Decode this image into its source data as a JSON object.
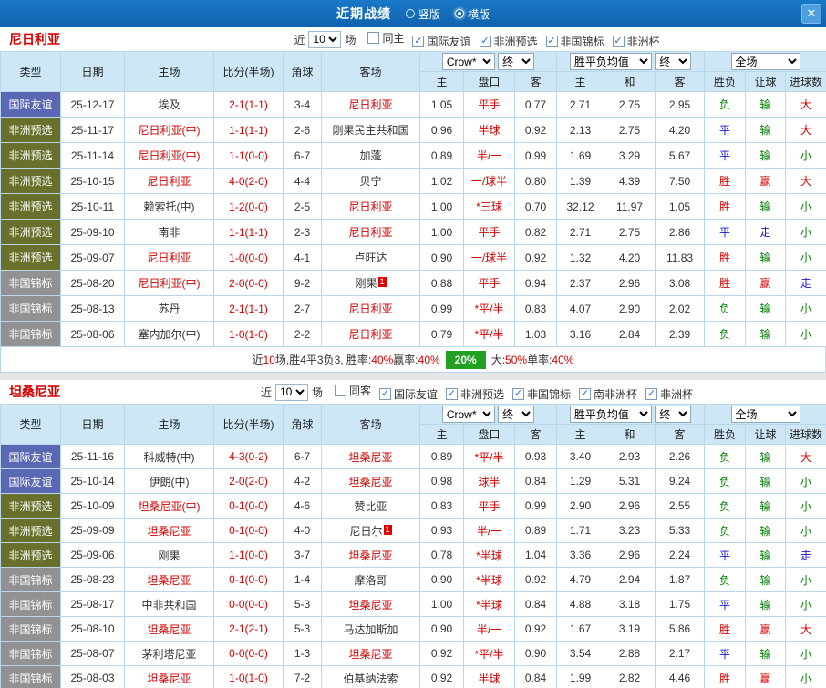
{
  "titlebar": {
    "title": "近期战绩",
    "layout_radios": [
      {
        "label": "竖版",
        "selected": false
      },
      {
        "label": "横版",
        "selected": true
      }
    ],
    "close_icon": "✕"
  },
  "labels": {
    "near": "近",
    "count": "10",
    "games": "场"
  },
  "table_meta": {
    "col_headers": [
      "类型",
      "日期",
      "主场",
      "比分(半场)",
      "角球",
      "客场"
    ],
    "sub_headers": [
      "主",
      "盘口",
      "客",
      "主",
      "和",
      "客",
      "胜负",
      "让球",
      "进球数"
    ],
    "dd_odds": "Crow*",
    "dd_final": "终",
    "dd_europe": "胜平负均值",
    "dd_scope": "全场"
  },
  "colors": {
    "accent": "#1269b7",
    "type_bg": {
      "国际友谊": "#5a68b4",
      "非洲预选": "#68702c",
      "非国锦标": "#929292"
    },
    "value": {
      "red": "#d60000",
      "blue": "#1414d6",
      "green": "#008000"
    },
    "score": "#d60000",
    "badge_green": "#22a022"
  },
  "value_kind": {
    "胜": "red",
    "赢": "red",
    "大": "red",
    "平": "blue",
    "走": "blue",
    "负": "green",
    "输": "green",
    "小": "green"
  },
  "sections": [
    {
      "team": "尼日利亚",
      "filters": [
        {
          "label": "同主",
          "checked": false
        },
        {
          "label": "国际友谊",
          "checked": true
        },
        {
          "label": "非洲预选",
          "checked": true
        },
        {
          "label": "非国锦标",
          "checked": true
        },
        {
          "label": "非洲杯",
          "checked": true
        }
      ],
      "rows": [
        {
          "type": "国际友谊",
          "date": "25-12-17",
          "home": "埃及",
          "hf": false,
          "score": "2-1(1-1)",
          "corner": "3-4",
          "away": "尼日利亚",
          "af": true,
          "w1": "1.05",
          "hc": "平手",
          "w2": "0.77",
          "o1": "2.71",
          "o2": "2.75",
          "o3": "2.95",
          "res": "负",
          "ah": "输",
          "gl": "大"
        },
        {
          "type": "非洲预选",
          "date": "25-11-17",
          "home": "尼日利亚(中)",
          "hf": true,
          "score": "1-1(1-1)",
          "corner": "2-6",
          "away": "刚果民主共和国",
          "af": false,
          "w1": "0.96",
          "hc": "半球",
          "w2": "0.92",
          "o1": "2.13",
          "o2": "2.75",
          "o3": "4.20",
          "res": "平",
          "ah": "输",
          "gl": "大"
        },
        {
          "type": "非洲预选",
          "date": "25-11-14",
          "home": "尼日利亚(中)",
          "hf": true,
          "score": "1-1(0-0)",
          "corner": "6-7",
          "away": "加蓬",
          "af": false,
          "w1": "0.89",
          "hc": "半/一",
          "w2": "0.99",
          "o1": "1.69",
          "o2": "3.29",
          "o3": "5.67",
          "res": "平",
          "ah": "输",
          "gl": "小"
        },
        {
          "type": "非洲预选",
          "date": "25-10-15",
          "home": "尼日利亚",
          "hf": true,
          "score": "4-0(2-0)",
          "corner": "4-4",
          "away": "贝宁",
          "af": false,
          "w1": "1.02",
          "hc": "一/球半",
          "w2": "0.80",
          "o1": "1.39",
          "o2": "4.39",
          "o3": "7.50",
          "res": "胜",
          "ah": "赢",
          "gl": "大"
        },
        {
          "type": "非洲预选",
          "date": "25-10-11",
          "home": "赖索托(中)",
          "hf": false,
          "score": "1-2(0-0)",
          "corner": "2-5",
          "away": "尼日利亚",
          "af": true,
          "w1": "1.00",
          "hc": "*三球",
          "w2": "0.70",
          "o1": "32.12",
          "o2": "11.97",
          "o3": "1.05",
          "res": "胜",
          "ah": "输",
          "gl": "小"
        },
        {
          "type": "非洲预选",
          "date": "25-09-10",
          "home": "南非",
          "hf": false,
          "score": "1-1(1-1)",
          "corner": "2-3",
          "away": "尼日利亚",
          "af": true,
          "w1": "1.00",
          "hc": "平手",
          "w2": "0.82",
          "o1": "2.71",
          "o2": "2.75",
          "o3": "2.86",
          "res": "平",
          "ah": "走",
          "gl": "小"
        },
        {
          "type": "非洲预选",
          "date": "25-09-07",
          "home": "尼日利亚",
          "hf": true,
          "score": "1-0(0-0)",
          "corner": "4-1",
          "away": "卢旺达",
          "af": false,
          "w1": "0.90",
          "hc": "一/球半",
          "w2": "0.92",
          "o1": "1.32",
          "o2": "4.20",
          "o3": "11.83",
          "res": "胜",
          "ah": "输",
          "gl": "小"
        },
        {
          "type": "非国锦标",
          "date": "25-08-20",
          "home": "尼日利亚(中)",
          "hf": true,
          "score": "2-0(0-0)",
          "corner": "9-2",
          "away": "刚果",
          "af": false,
          "away_badge": "1",
          "w1": "0.88",
          "hc": "平手",
          "w2": "0.94",
          "o1": "2.37",
          "o2": "2.96",
          "o3": "3.08",
          "res": "胜",
          "ah": "赢",
          "gl": "走"
        },
        {
          "type": "非国锦标",
          "date": "25-08-13",
          "home": "苏丹",
          "hf": false,
          "score": "2-1(1-1)",
          "corner": "2-7",
          "away": "尼日利亚",
          "af": true,
          "w1": "0.99",
          "hc": "*平/半",
          "w2": "0.83",
          "o1": "4.07",
          "o2": "2.90",
          "o3": "2.02",
          "res": "负",
          "ah": "输",
          "gl": "小"
        },
        {
          "type": "非国锦标",
          "date": "25-08-06",
          "home": "塞内加尔(中)",
          "hf": false,
          "score": "1-0(1-0)",
          "corner": "2-2",
          "away": "尼日利亚",
          "af": true,
          "w1": "0.79",
          "hc": "*平/半",
          "w2": "1.03",
          "o1": "3.16",
          "o2": "2.84",
          "o3": "2.39",
          "res": "负",
          "ah": "输",
          "gl": "小"
        }
      ],
      "summary": [
        {
          "t": "近",
          "k": "dark"
        },
        {
          "t": "10",
          "k": "red"
        },
        {
          "t": "场,胜4平3负3, 胜率:",
          "k": "dark"
        },
        {
          "t": "40%",
          "k": "red"
        },
        {
          "t": " 赢率:",
          "k": "dark"
        },
        {
          "t": "40%",
          "k": "red"
        },
        {
          "t": "20%",
          "k": "badge"
        },
        {
          "t": " 大:",
          "k": "dark"
        },
        {
          "t": "50%",
          "k": "red"
        },
        {
          "t": " 单率:",
          "k": "dark"
        },
        {
          "t": "40%",
          "k": "red"
        }
      ]
    },
    {
      "team": "坦桑尼亚",
      "filters": [
        {
          "label": "同客",
          "checked": false
        },
        {
          "label": "国际友谊",
          "checked": true
        },
        {
          "label": "非洲预选",
          "checked": true
        },
        {
          "label": "非国锦标",
          "checked": true
        },
        {
          "label": "南非洲杯",
          "checked": true
        },
        {
          "label": "非洲杯",
          "checked": true
        }
      ],
      "rows": [
        {
          "type": "国际友谊",
          "date": "25-11-16",
          "home": "科威特(中)",
          "hf": false,
          "score": "4-3(0-2)",
          "corner": "6-7",
          "away": "坦桑尼亚",
          "af": true,
          "w1": "0.89",
          "hc": "*平/半",
          "w2": "0.93",
          "o1": "3.40",
          "o2": "2.93",
          "o3": "2.26",
          "res": "负",
          "ah": "输",
          "gl": "大"
        },
        {
          "type": "国际友谊",
          "date": "25-10-14",
          "home": "伊朗(中)",
          "hf": false,
          "score": "2-0(2-0)",
          "corner": "4-2",
          "away": "坦桑尼亚",
          "af": true,
          "w1": "0.98",
          "hc": "球半",
          "w2": "0.84",
          "o1": "1.29",
          "o2": "5.31",
          "o3": "9.24",
          "res": "负",
          "ah": "输",
          "gl": "小"
        },
        {
          "type": "非洲预选",
          "date": "25-10-09",
          "home": "坦桑尼亚(中)",
          "hf": true,
          "score": "0-1(0-0)",
          "corner": "4-6",
          "away": "赞比亚",
          "af": false,
          "w1": "0.83",
          "hc": "平手",
          "w2": "0.99",
          "o1": "2.90",
          "o2": "2.96",
          "o3": "2.55",
          "res": "负",
          "ah": "输",
          "gl": "小"
        },
        {
          "type": "非洲预选",
          "date": "25-09-09",
          "home": "坦桑尼亚",
          "hf": true,
          "score": "0-1(0-0)",
          "corner": "4-0",
          "away": "尼日尔",
          "af": false,
          "away_badge": "1",
          "w1": "0.93",
          "hc": "半/一",
          "w2": "0.89",
          "o1": "1.71",
          "o2": "3.23",
          "o3": "5.33",
          "res": "负",
          "ah": "输",
          "gl": "小"
        },
        {
          "type": "非洲预选",
          "date": "25-09-06",
          "home": "刚果",
          "hf": false,
          "score": "1-1(0-0)",
          "corner": "3-7",
          "away": "坦桑尼亚",
          "af": true,
          "w1": "0.78",
          "hc": "*半球",
          "w2": "1.04",
          "o1": "3.36",
          "o2": "2.96",
          "o3": "2.24",
          "res": "平",
          "ah": "输",
          "gl": "走"
        },
        {
          "type": "非国锦标",
          "date": "25-08-23",
          "home": "坦桑尼亚",
          "hf": true,
          "score": "0-1(0-0)",
          "corner": "1-4",
          "away": "摩洛哥",
          "af": false,
          "w1": "0.90",
          "hc": "*半球",
          "w2": "0.92",
          "o1": "4.79",
          "o2": "2.94",
          "o3": "1.87",
          "res": "负",
          "ah": "输",
          "gl": "小"
        },
        {
          "type": "非国锦标",
          "date": "25-08-17",
          "home": "中非共和国",
          "hf": false,
          "score": "0-0(0-0)",
          "corner": "5-3",
          "away": "坦桑尼亚",
          "af": true,
          "w1": "1.00",
          "hc": "*半球",
          "w2": "0.84",
          "o1": "4.88",
          "o2": "3.18",
          "o3": "1.75",
          "res": "平",
          "ah": "输",
          "gl": "小"
        },
        {
          "type": "非国锦标",
          "date": "25-08-10",
          "home": "坦桑尼亚",
          "hf": true,
          "score": "2-1(2-1)",
          "corner": "5-3",
          "away": "马达加斯加",
          "af": false,
          "w1": "0.90",
          "hc": "半/一",
          "w2": "0.92",
          "o1": "1.67",
          "o2": "3.19",
          "o3": "5.86",
          "res": "胜",
          "ah": "赢",
          "gl": "大"
        },
        {
          "type": "非国锦标",
          "date": "25-08-07",
          "home": "茅利塔尼亚",
          "hf": false,
          "score": "0-0(0-0)",
          "corner": "1-3",
          "away": "坦桑尼亚",
          "af": true,
          "w1": "0.92",
          "hc": "*平/半",
          "w2": "0.90",
          "o1": "3.54",
          "o2": "2.88",
          "o3": "2.17",
          "res": "平",
          "ah": "输",
          "gl": "小"
        },
        {
          "type": "非国锦标",
          "date": "25-08-03",
          "home": "坦桑尼亚",
          "hf": true,
          "score": "1-0(1-0)",
          "corner": "7-2",
          "away": "伯基纳法索",
          "af": false,
          "w1": "0.92",
          "hc": "半球",
          "w2": "0.84",
          "o1": "1.99",
          "o2": "2.82",
          "o3": "4.46",
          "res": "胜",
          "ah": "赢",
          "gl": "小"
        }
      ],
      "summary": []
    }
  ]
}
